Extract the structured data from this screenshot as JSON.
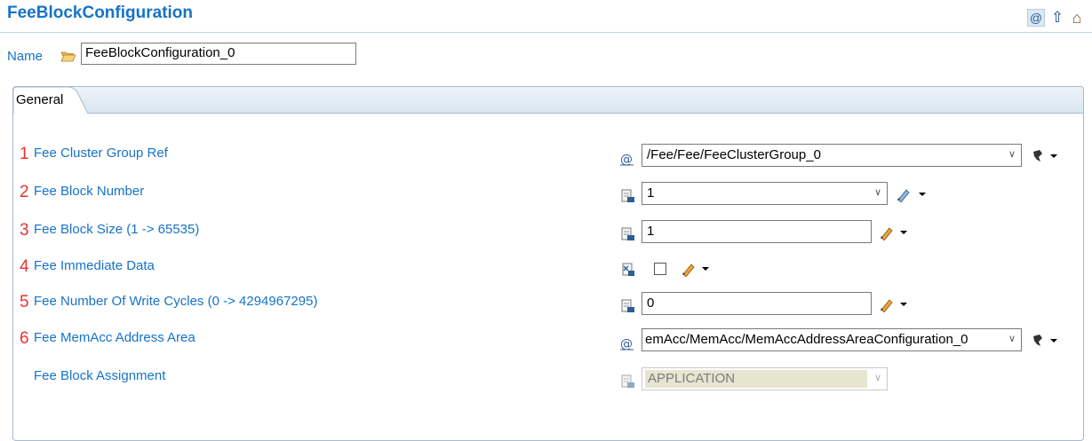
{
  "header": {
    "title": "FeeBlockConfiguration"
  },
  "top_icons": [
    {
      "name": "at-icon",
      "glyph": "@"
    },
    {
      "name": "up-arrow-icon",
      "glyph": "⇧"
    },
    {
      "name": "home-icon",
      "glyph": "⌂"
    }
  ],
  "name_field": {
    "label": "Name",
    "value": "FeeBlockConfiguration_0"
  },
  "tabs": [
    {
      "label": "General"
    }
  ],
  "rows": [
    {
      "number": "1",
      "label": "Fee Cluster Group Ref",
      "value": "/Fee/Fee/FeeClusterGroup_0"
    },
    {
      "number": "2",
      "label": "Fee Block Number",
      "value": "1"
    },
    {
      "number": "3",
      "label": "Fee Block Size (1 -> 65535)",
      "value": "1"
    },
    {
      "number": "4",
      "label": "Fee Immediate Data",
      "checked": false
    },
    {
      "number": "5",
      "label": "Fee Number Of Write Cycles (0 -> 4294967295)",
      "value": "0"
    },
    {
      "number": "6",
      "label": "Fee MemAcc Address Area",
      "value": "emAcc/MemAcc/MemAccAddressAreaConfiguration_0"
    },
    {
      "number": "",
      "label": "Fee Block Assignment",
      "value": "APPLICATION"
    }
  ],
  "colors": {
    "label_blue": "#1673c7",
    "marker_red": "#e8332d",
    "border": "#7a7a7a"
  }
}
